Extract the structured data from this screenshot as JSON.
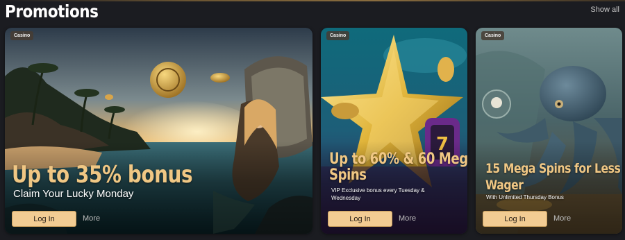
{
  "section": {
    "title": "Promotions",
    "show_all": "Show all"
  },
  "cards": [
    {
      "badge": "Casino",
      "title": "Up to 35% bonus",
      "subtitle": "Claim Your Lucky Monday",
      "button": "Log In",
      "more": "More"
    },
    {
      "badge": "Casino",
      "title_line1": "Up to 60% & 60 Mega",
      "title_line2": "Spins",
      "subtitle_line1": "VIP Exclusive bonus every Tuesday &",
      "subtitle_line2": "Wednesday",
      "button": "Log In",
      "more": "More"
    },
    {
      "badge": "Casino",
      "title_line1": "15 Mega Spins for Less",
      "title_line2": "Wager",
      "subtitle": "With Unlimited Thursday Bonus",
      "button": "Log In",
      "more": "More"
    }
  ],
  "colors": {
    "background": "#1b1c21",
    "title_accent": "#f0c784",
    "button_fill": "#f2cc93",
    "badge_bg": "#463c32"
  }
}
